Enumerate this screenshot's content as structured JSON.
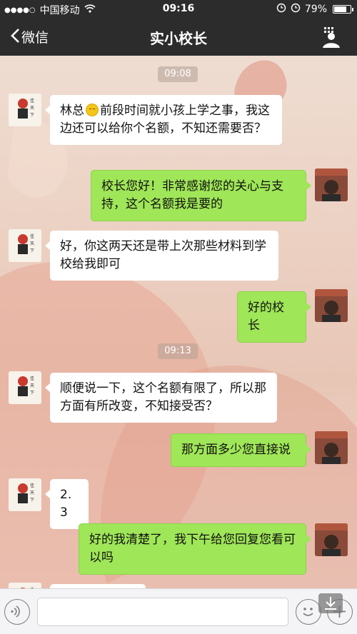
{
  "status_bar": {
    "signal": "●●●●○",
    "carrier": "中国移动",
    "time": "09:16",
    "battery": "79%",
    "battery_level": 0.79
  },
  "nav": {
    "back_label": "微信",
    "title": "实小校长"
  },
  "messages": [
    {
      "type": "time",
      "text": "09:08"
    },
    {
      "type": "in",
      "text_before": "林总",
      "text_after": "前段时间就小孩上学之事，我这边还可以给你个名额，不知还需要否？",
      "emoji": "smile-emoji"
    },
    {
      "type": "out",
      "text": "校长您好！非常感谢您的关心与支持，这个名额我是要的"
    },
    {
      "type": "in",
      "text": "好，你这两天还是带上次那些材料到学校给我即可"
    },
    {
      "type": "out",
      "text": "好的校长"
    },
    {
      "type": "time",
      "text": "09:13"
    },
    {
      "type": "in",
      "text": "顺便说一下，这个名额有限了，所以那方面有所改变，不知接受否？"
    },
    {
      "type": "out",
      "text": "那方面多少您直接说"
    },
    {
      "type": "in",
      "text": "2.3"
    },
    {
      "type": "out",
      "text": "好的我清楚了，我下午给您回复您看可以吗"
    }
  ],
  "colors": {
    "bar": "#2c2c2c",
    "bubble_out": "#9fe658",
    "bubble_in": "#ffffff"
  },
  "icons": {
    "back": "chevron-left-icon",
    "profile": "person-icon",
    "voice": "voice-icon",
    "emoji": "emoji-icon",
    "plus": "plus-icon",
    "download": "download-icon"
  }
}
